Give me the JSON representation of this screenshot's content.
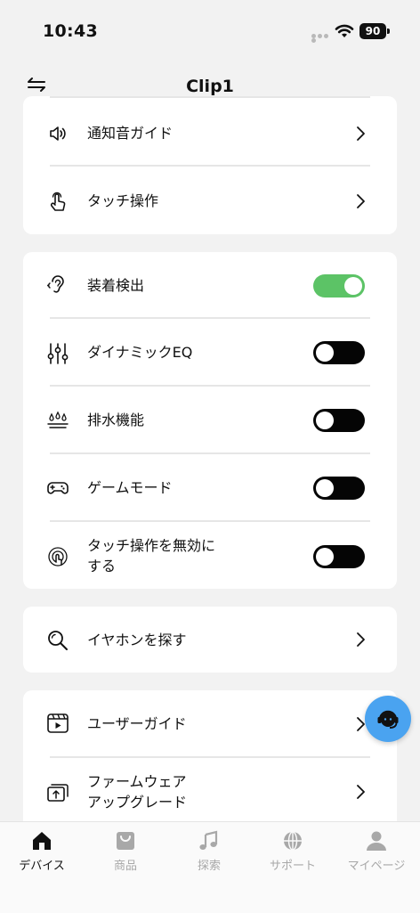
{
  "status_bar": {
    "time": "10:43",
    "battery": "90"
  },
  "header": {
    "title": "Clip1"
  },
  "settings": {
    "notification_sound_guide": "通知音ガイド",
    "touch_controls": "タッチ操作",
    "wear_detection": "装着検出",
    "dynamic_eq": "ダイナミックEQ",
    "drainage": "排水機能",
    "game_mode": "ゲームモード",
    "disable_touch": [
      "タッチ操作を無効に",
      "する"
    ],
    "find_earphones": "イヤホンを探す",
    "user_guide": "ユーザーガイド",
    "firmware_upgrade": [
      "ファームウェア",
      "アップグレード"
    ]
  },
  "toggles": {
    "wear_detection": "on",
    "dynamic_eq": "off",
    "drainage": "off",
    "game_mode": "off",
    "disable_touch": "off"
  },
  "colors": {
    "toggle_on": "#5cc366",
    "toggle_off": "#050505",
    "support_button": "#4aa3f0"
  },
  "tabs": [
    {
      "label": "デバイス",
      "icon": "home-icon",
      "active": true
    },
    {
      "label": "商品",
      "icon": "shopping-bag-icon",
      "active": false
    },
    {
      "label": "探索",
      "icon": "music-note-icon",
      "active": false
    },
    {
      "label": "サポート",
      "icon": "globe-icon",
      "active": false
    },
    {
      "label": "マイページ",
      "icon": "person-icon",
      "active": false
    }
  ]
}
